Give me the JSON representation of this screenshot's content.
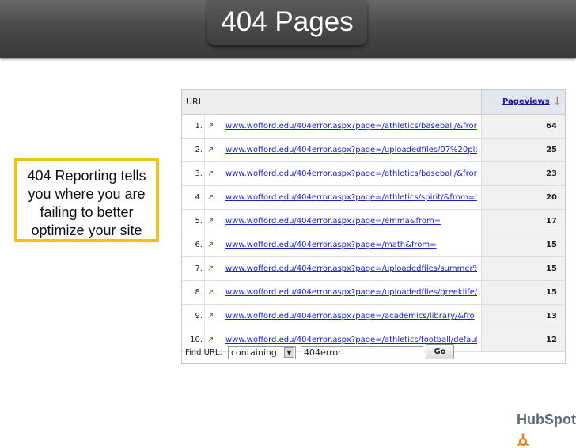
{
  "slide": {
    "title": "404 Pages",
    "callout_lines": [
      "404 Reporting tells",
      "you where you are",
      "failing to better",
      "optimize your site"
    ],
    "accent_color": "#f2c21b"
  },
  "report": {
    "header": {
      "url_label": "URL",
      "pageviews_label": "Pageviews"
    },
    "rows": [
      {
        "rank": "1.",
        "url": "www.wofford.edu/404error.aspx?page=/athletics/baseball/&fror",
        "pageviews": "64"
      },
      {
        "rank": "2.",
        "url": "www.wofford.edu/404error.aspx?page=/uploadedfiles/07%20pla",
        "pageviews": "25"
      },
      {
        "rank": "3.",
        "url": "www.wofford.edu/404error.aspx?page=/athletics/baseball/&fror",
        "pageviews": "23"
      },
      {
        "rank": "4.",
        "url": "www.wofford.edu/404error.aspx?page=/athletics/spirit/&from=h",
        "pageviews": "20"
      },
      {
        "rank": "5.",
        "url": "www.wofford.edu/404error.aspx?page=/emma&from=",
        "pageviews": "17"
      },
      {
        "rank": "6.",
        "url": "www.wofford.edu/404error.aspx?page=/math&from=",
        "pageviews": "15"
      },
      {
        "rank": "7.",
        "url": "www.wofford.edu/404error.aspx?page=/uploadedfiles/summer%",
        "pageviews": "15"
      },
      {
        "rank": "8.",
        "url": "www.wofford.edu/404error.aspx?page=/uploadedfiles/greeklife/",
        "pageviews": "15"
      },
      {
        "rank": "9.",
        "url": "www.wofford.edu/404error.aspx?page=/academics/library/&fro",
        "pageviews": "13"
      },
      {
        "rank": "10.",
        "url": "www.wofford.edu/404error.aspx?page=/athletics/football/defaul",
        "pageviews": "12"
      }
    ],
    "find": {
      "label": "Find URL:",
      "match_type": "containing",
      "query": "404error",
      "go_label": "Go"
    }
  },
  "icons": {
    "sort": "arrow-down-icon",
    "row_link": "external-link-icon",
    "logo": "hubspot-sprocket-icon"
  },
  "logo": {
    "text": "HubSpot",
    "color": "#5a6a78",
    "accent": "#f47b20"
  }
}
